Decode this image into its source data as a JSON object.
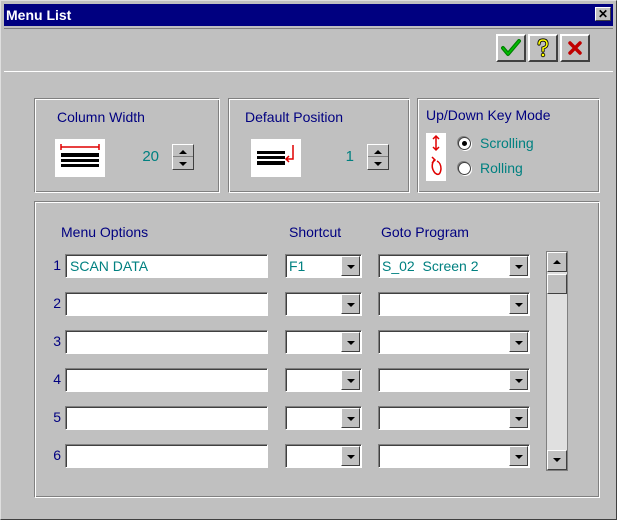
{
  "window": {
    "title": "Menu List",
    "close_glyph": "✕"
  },
  "toolbar": {
    "buttons": [
      {
        "name": "ok",
        "icon": "check-icon",
        "color": "#008000"
      },
      {
        "name": "help",
        "icon": "question-icon",
        "color": "#808000"
      },
      {
        "name": "cancel",
        "icon": "x-icon",
        "color": "#c00000"
      }
    ]
  },
  "column_width": {
    "label": "Column Width",
    "value": "20"
  },
  "default_position": {
    "label": "Default Position",
    "value": "1"
  },
  "key_mode": {
    "label": "Up/Down Key Mode",
    "options": [
      {
        "label": "Scrolling",
        "selected": true
      },
      {
        "label": "Rolling",
        "selected": false
      }
    ]
  },
  "menu_table": {
    "headers": {
      "options": "Menu Options",
      "shortcut": "Shortcut",
      "goto": "Goto Program"
    },
    "rows": [
      {
        "num": "1",
        "option": "SCAN DATA",
        "shortcut": "F1",
        "goto": "S_02  Screen 2"
      },
      {
        "num": "2",
        "option": "",
        "shortcut": "",
        "goto": ""
      },
      {
        "num": "3",
        "option": "",
        "shortcut": "",
        "goto": ""
      },
      {
        "num": "4",
        "option": "",
        "shortcut": "",
        "goto": ""
      },
      {
        "num": "5",
        "option": "",
        "shortcut": "",
        "goto": ""
      },
      {
        "num": "6",
        "option": "",
        "shortcut": "",
        "goto": ""
      }
    ]
  },
  "colors": {
    "title_bar": "#000080",
    "label_text": "#000080",
    "value_text": "#008080",
    "face": "#c0c0c0"
  }
}
